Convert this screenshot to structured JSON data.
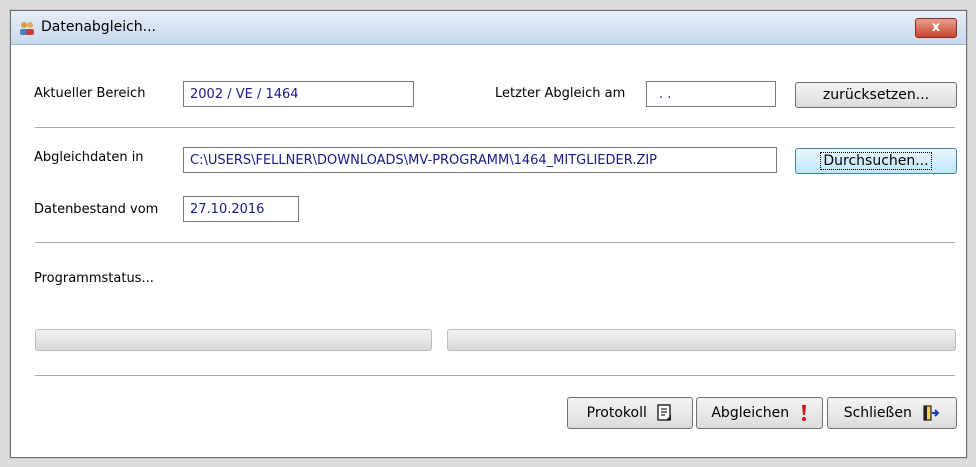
{
  "window": {
    "title": "Datenabgleich...",
    "close_label": "x"
  },
  "area": {
    "label": "Aktueller Bereich",
    "value": "2002 / VE / 1464"
  },
  "last_sync": {
    "label": "Letzter Abgleich am",
    "value": ". .",
    "reset_label": "zurücksetzen..."
  },
  "sync_data": {
    "label": "Abgleichdaten in",
    "path": "C:\\USERS\\FELLNER\\DOWNLOADS\\MV-PROGRAMM\\1464_MITGLIEDER.ZIP",
    "browse_label": "Durchsuchen..."
  },
  "dataset": {
    "label": "Datenbestand vom",
    "value": "27.10.2016"
  },
  "status": {
    "label": "Programmstatus...",
    "progress_left": 0,
    "progress_right": 0
  },
  "buttons": {
    "protocol_label": "Protokoll",
    "sync_label": "Abgleichen",
    "close_label": "Schließen"
  },
  "colors": {
    "value_text": "#1a1a8a",
    "close_button": "#c8442e"
  },
  "icons": {
    "app": "users-icon",
    "protocol": "document-icon",
    "sync": "exclamation-icon",
    "close": "exit-door-icon"
  }
}
